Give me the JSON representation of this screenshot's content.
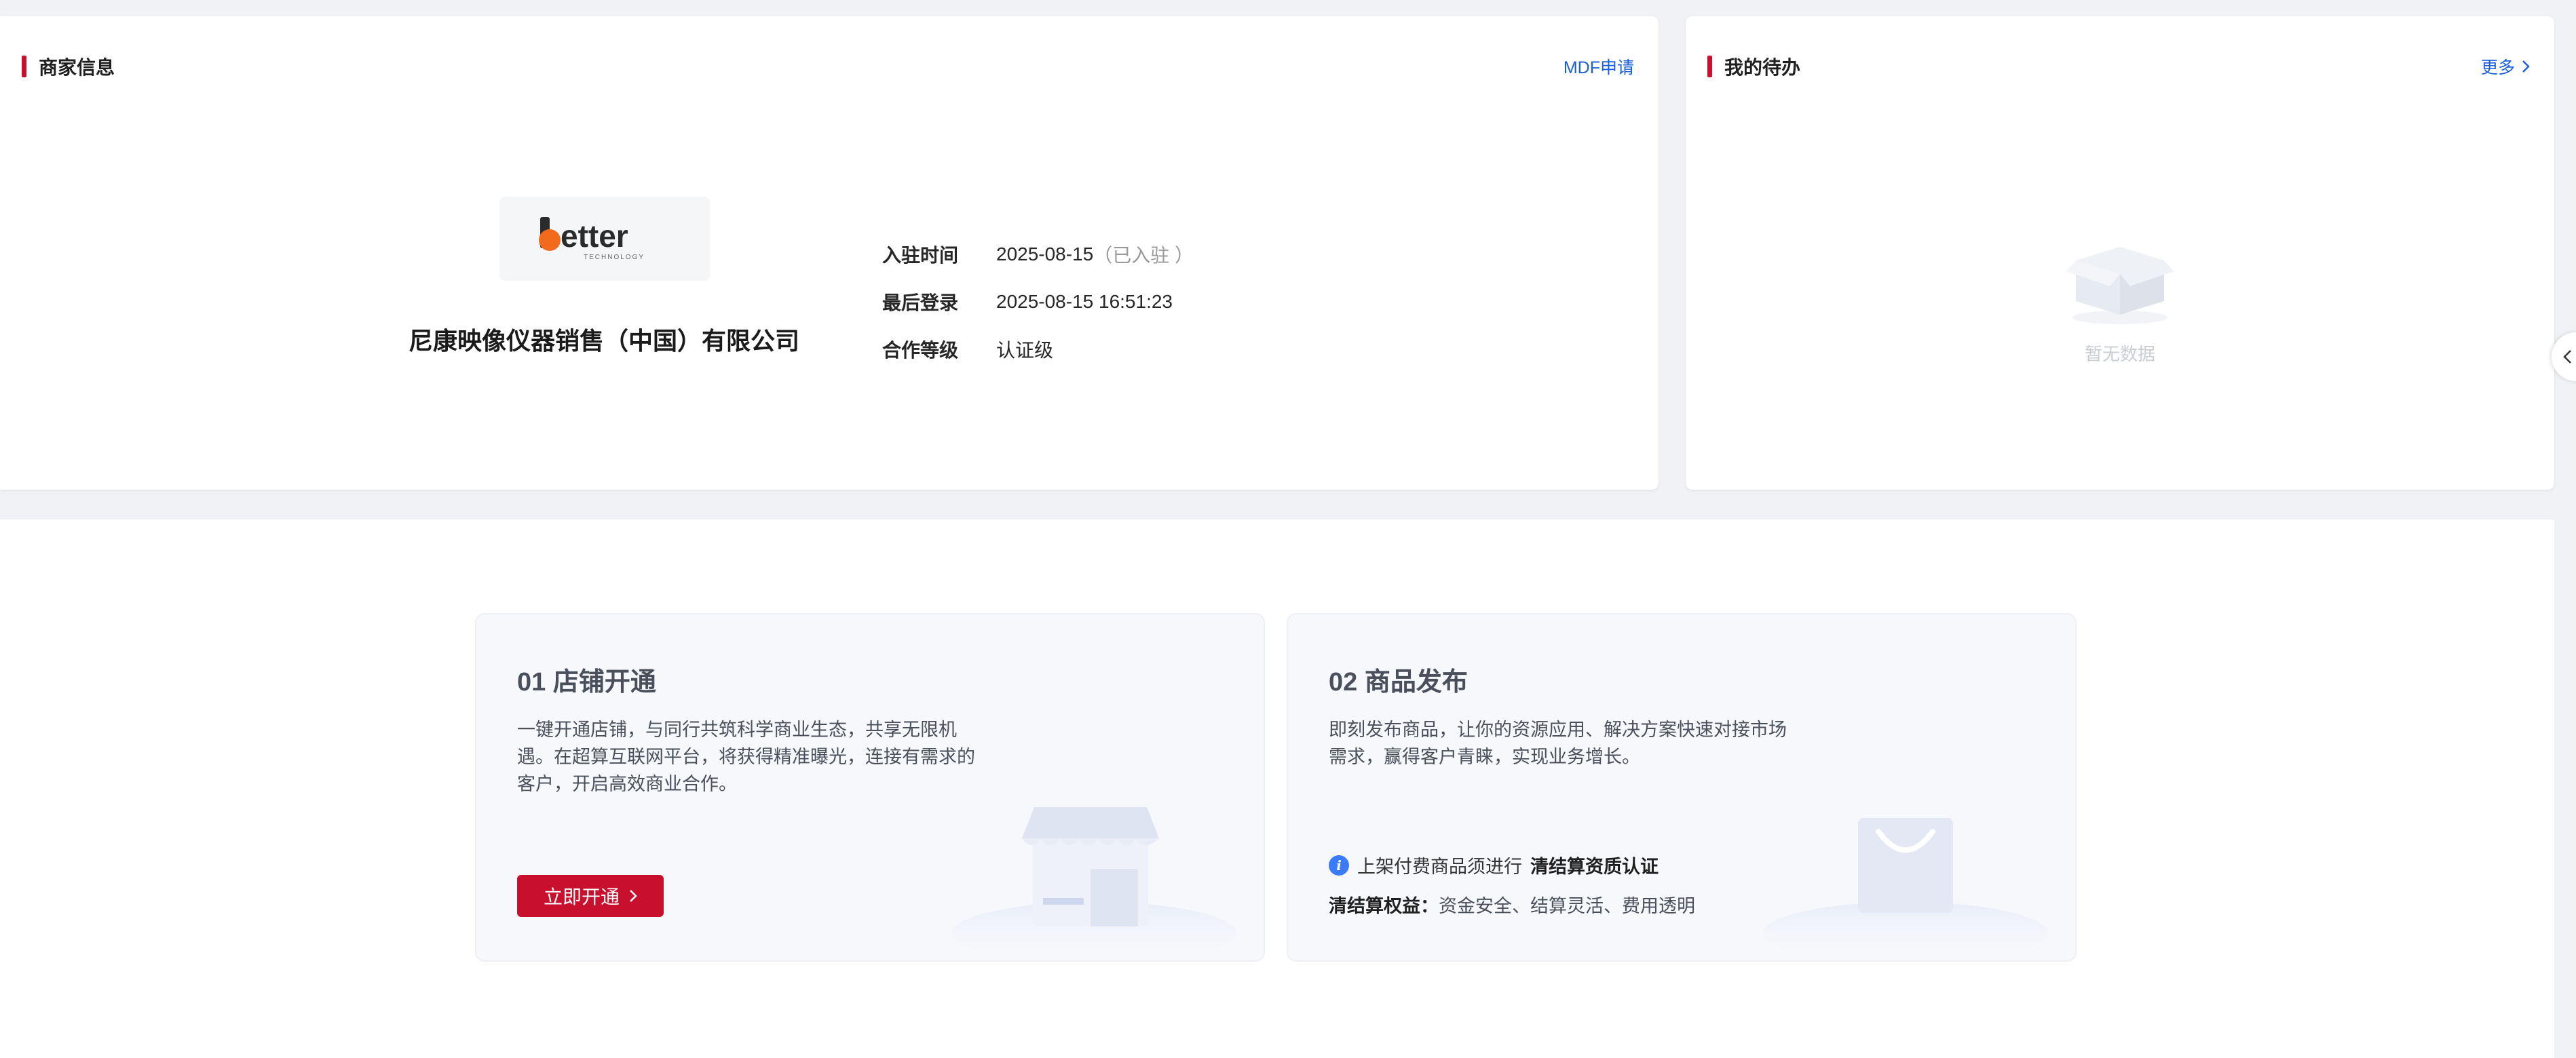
{
  "merchant": {
    "title": "商家信息",
    "mdf_link": "MDF申请",
    "logo_text": "etter",
    "logo_sub": "TECHNOLOGY",
    "company_name": "尼康映像仪器销售（中国）有限公司",
    "rows": [
      {
        "label": "入驻时间",
        "value": "2025-08-15",
        "note": "（已入驻 ）"
      },
      {
        "label": "最后登录",
        "value": "2025-08-15 16:51:23",
        "note": ""
      },
      {
        "label": "合作等级",
        "value": "认证级",
        "note": ""
      }
    ]
  },
  "todo": {
    "title": "我的待办",
    "more_link": "更多",
    "empty_text": "暂无数据"
  },
  "steps": {
    "store": {
      "title": "01 店铺开通",
      "desc": "一键开通店铺，与同行共筑科学商业生态，共享无限机遇。在超算互联网平台，将获得精准曝光，连接有需求的客户，开启高效商业合作。",
      "button": "立即开通"
    },
    "product": {
      "title": "02 商品发布",
      "desc": "即刻发布商品，让你的资源应用、解决方案快速对接市场需求，赢得客户青睐，实现业务增长。",
      "notice_prefix": "上架付费商品须进行",
      "notice_bold": "清结算资质认证",
      "benefit_label": "清结算权益：",
      "benefit_text": "资金安全、结算灵活、费用透明"
    }
  },
  "colors": {
    "brand_red": "#c8102e",
    "link_blue": "#1a5fd8",
    "logo_orange": "#f26b1d"
  }
}
